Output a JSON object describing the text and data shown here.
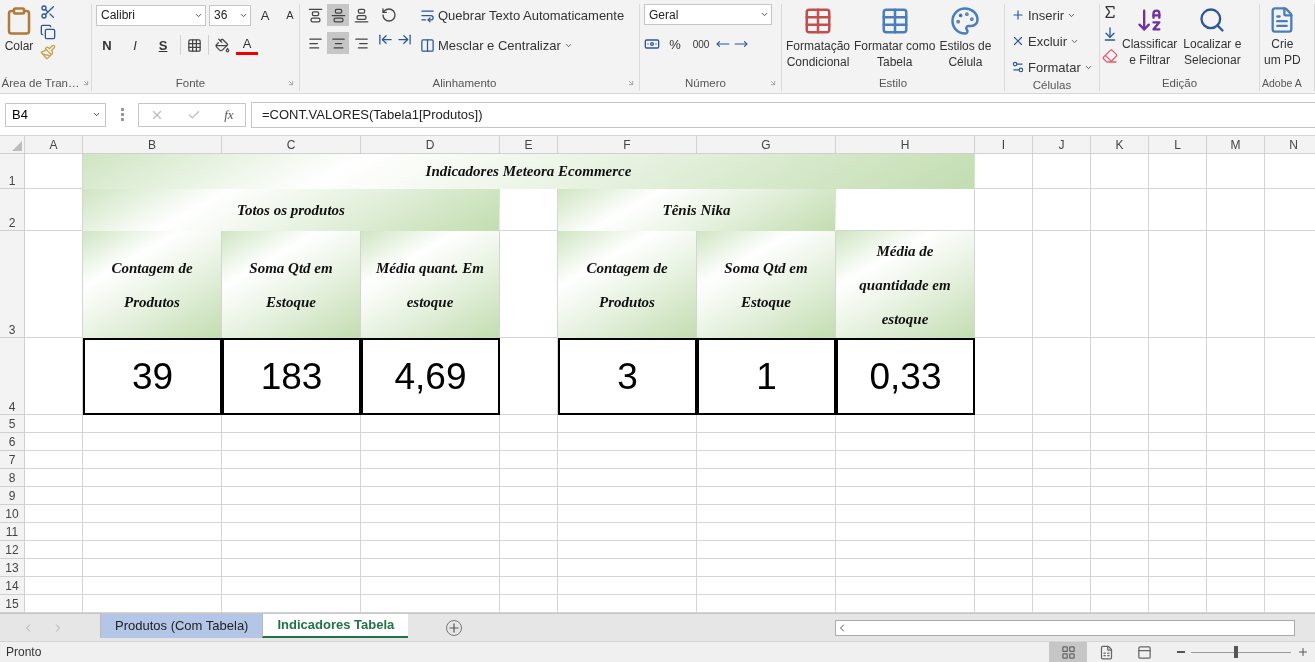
{
  "ribbon": {
    "clipboard": {
      "label": "Área de Tran…",
      "paste": "Colar"
    },
    "font": {
      "label": "Fonte",
      "family": "Calibri",
      "size": "36",
      "grow": "A",
      "shrink": "A",
      "bold": "N",
      "italic": "I",
      "underline": "S",
      "color_letter": "A"
    },
    "alignment": {
      "label": "Alinhamento",
      "vertical": [
        {
          "selected": false
        },
        {
          "selected": true
        },
        {
          "selected": false
        }
      ],
      "horizontal": [
        {
          "selected": false
        },
        {
          "selected": true
        },
        {
          "selected": false
        }
      ],
      "wrap": "Quebrar Texto Automaticamente",
      "merge": "Mesclar e Centralizar"
    },
    "number": {
      "label": "Número",
      "format": "Geral",
      "percent": "%",
      "thousands": "000"
    },
    "styles": {
      "label": "Estilo",
      "buttons": [
        "Formatação\nCondicional",
        "Formatar como\nTabela",
        "Estilos de\nCélula"
      ]
    },
    "cells": {
      "label": "Células",
      "buttons": [
        "Inserir",
        "Excluir",
        "Formatar"
      ]
    },
    "editing": {
      "label": "Edição",
      "buttons": [
        "Classificar\ne Filtrar",
        "Localizar e\nSelecionar"
      ]
    },
    "adobe": {
      "label": "Adobe A",
      "button": "Crie\num PD"
    }
  },
  "formula_bar": {
    "name_box": "B4",
    "fx": "fx",
    "formula": "=CONT.VALORES(Tabela1[Produtos])"
  },
  "sheet": {
    "columns": [
      "A",
      "B",
      "C",
      "D",
      "E",
      "F",
      "G",
      "H",
      "I",
      "J",
      "K",
      "L",
      "M",
      "N"
    ],
    "rows": [
      "1",
      "2",
      "3",
      "4",
      "5",
      "6",
      "7",
      "8",
      "9",
      "10",
      "11",
      "12",
      "13",
      "14",
      "15"
    ],
    "title": "Indicadores Meteora Ecommerce",
    "groups": [
      {
        "title": "Totos os produtos",
        "headers": [
          "Contagem de Produtos",
          "Soma Qtd em Estoque",
          "Média quant. Em estoque"
        ],
        "values": [
          "39",
          "183",
          "4,69"
        ]
      },
      {
        "title": "Tênis Nika",
        "headers": [
          "Contagem de Produtos",
          "Soma Qtd em Estoque",
          "Média de quantidade em estoque"
        ],
        "values": [
          "3",
          "1",
          "0,33"
        ]
      }
    ]
  },
  "tabs": [
    {
      "label": "Produtos (Com Tabela)",
      "selected": false,
      "color": "#b4c6e7"
    },
    {
      "label": "Indicadores Tabela",
      "selected": true
    }
  ],
  "status_bar": {
    "text": "Pronto",
    "views": [
      {
        "selected": true
      },
      {
        "selected": false
      },
      {
        "selected": false
      }
    ],
    "zoom": {
      "level": 0.45
    }
  }
}
